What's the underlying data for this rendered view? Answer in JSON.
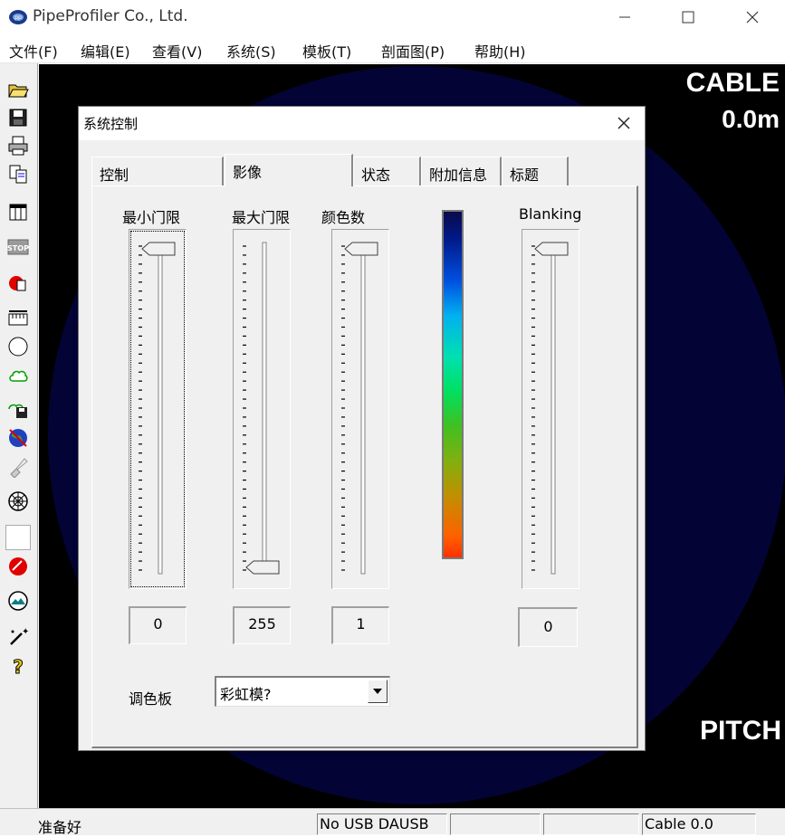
{
  "window": {
    "title": "PipeProfiler Co., Ltd.",
    "minimize": "—",
    "maximize": "☐",
    "close": "✕"
  },
  "menu": [
    "文件(F)",
    "编辑(E)",
    "查看(V)",
    "系统(S)",
    "模板(T)",
    "剖面图(P)",
    "帮助(H)"
  ],
  "toolbar": [
    "open-folder-icon",
    "save-disk-icon",
    "print-icon",
    "copy-icon",
    "calendar-icon",
    "stop-icon",
    "record-icon",
    "ruler-icon",
    "circle-icon",
    "cloud-shape-icon",
    "save-profile-icon",
    "globe-icon",
    "brush-icon",
    "compass-icon",
    "blank-icon",
    "red-ball-icon",
    "gauge-icon",
    "magic-wand-icon",
    "help-icon"
  ],
  "display": {
    "cable_label": "CABLE",
    "cable_value": "0.0m",
    "pitch_label": "PITCH",
    "background": "#000000",
    "circle_color": "#030335"
  },
  "dialog": {
    "title": "系统控制",
    "close": "✕",
    "tabs": [
      {
        "label": "控制",
        "active": false
      },
      {
        "label": "影像",
        "active": true
      },
      {
        "label": "状态",
        "active": false
      },
      {
        "label": "附加信息",
        "active": false
      },
      {
        "label": "标题",
        "active": false
      }
    ],
    "sliders": [
      {
        "label": "最小门限",
        "value": "0",
        "fraction": 0.0
      },
      {
        "label": "最大门限",
        "value": "255",
        "fraction": 1.0
      },
      {
        "label": "颜色数",
        "value": "1",
        "fraction": 0.0
      },
      {
        "label": "Blanking",
        "value": "0",
        "fraction": 0.0
      }
    ],
    "palette_label": "调色板",
    "palette_value": "彩虹模?"
  },
  "status": {
    "ready": "准备好",
    "usb": "No USB DAUSB",
    "cell3": "",
    "cell4": "",
    "cable": "Cable 0.0"
  }
}
